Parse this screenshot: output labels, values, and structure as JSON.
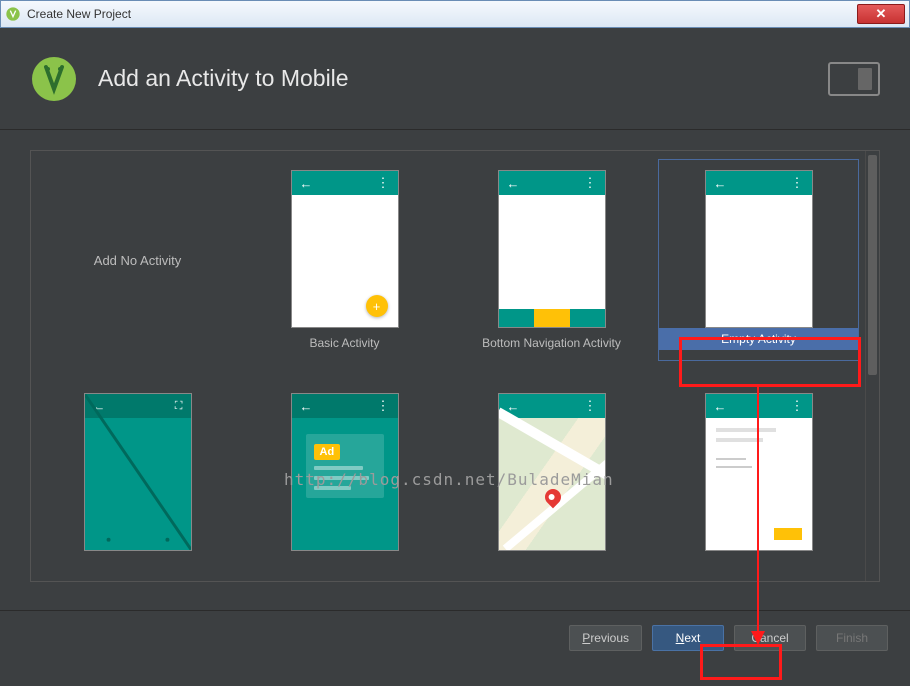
{
  "window": {
    "title": "Create New Project"
  },
  "header": {
    "title": "Add an Activity to Mobile"
  },
  "watermark": "http://blog.csdn.net/BuladeMian",
  "tiles": {
    "no_activity": "Add No Activity",
    "basic": "Basic Activity",
    "bottom_nav": "Bottom Navigation Activity",
    "empty": "Empty Activity",
    "ad_label": "Ad"
  },
  "buttons": {
    "previous": "Previous",
    "next": "Next",
    "cancel": "Cancel",
    "finish": "Finish"
  },
  "colors": {
    "teal": "#009688",
    "amber": "#ffc107",
    "selected_blue": "#4a6ea9",
    "annotation_red": "#ff1a1a"
  },
  "selected_tile": "empty"
}
